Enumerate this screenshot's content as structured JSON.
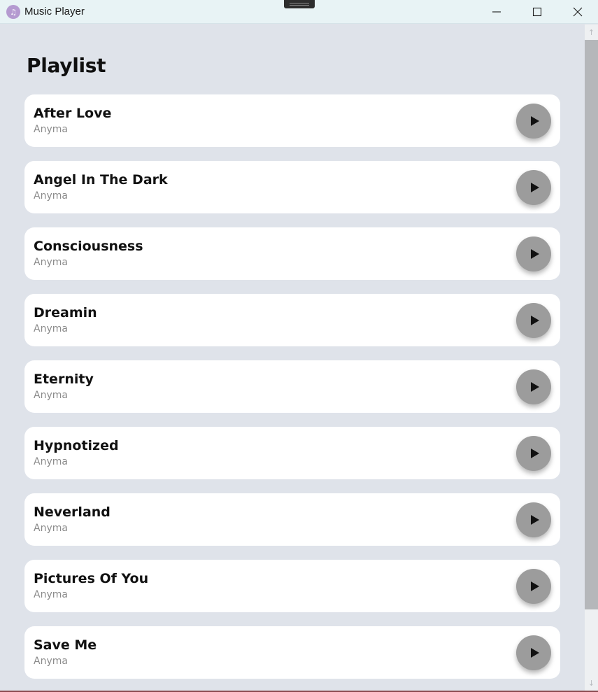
{
  "window": {
    "title": "Music Player",
    "app_icon": "music-note-icon",
    "controls": [
      "minimize-icon",
      "maximize-icon",
      "close-icon"
    ]
  },
  "page": {
    "title": "Playlist"
  },
  "songs": [
    {
      "title": "After Love",
      "artist": "Anyma"
    },
    {
      "title": "Angel In The Dark",
      "artist": "Anyma"
    },
    {
      "title": "Consciousness",
      "artist": "Anyma"
    },
    {
      "title": "Dreamin",
      "artist": "Anyma"
    },
    {
      "title": "Eternity",
      "artist": "Anyma"
    },
    {
      "title": "Hypnotized",
      "artist": "Anyma"
    },
    {
      "title": "Neverland",
      "artist": "Anyma"
    },
    {
      "title": "Pictures Of You",
      "artist": "Anyma"
    },
    {
      "title": "Save Me",
      "artist": "Anyma"
    }
  ],
  "colors": {
    "background": "#dfe3ea",
    "card": "#ffffff",
    "play_button": "#9c9c9c",
    "artist_text": "#8b8b8b",
    "titlebar": "#e8f3f5"
  }
}
